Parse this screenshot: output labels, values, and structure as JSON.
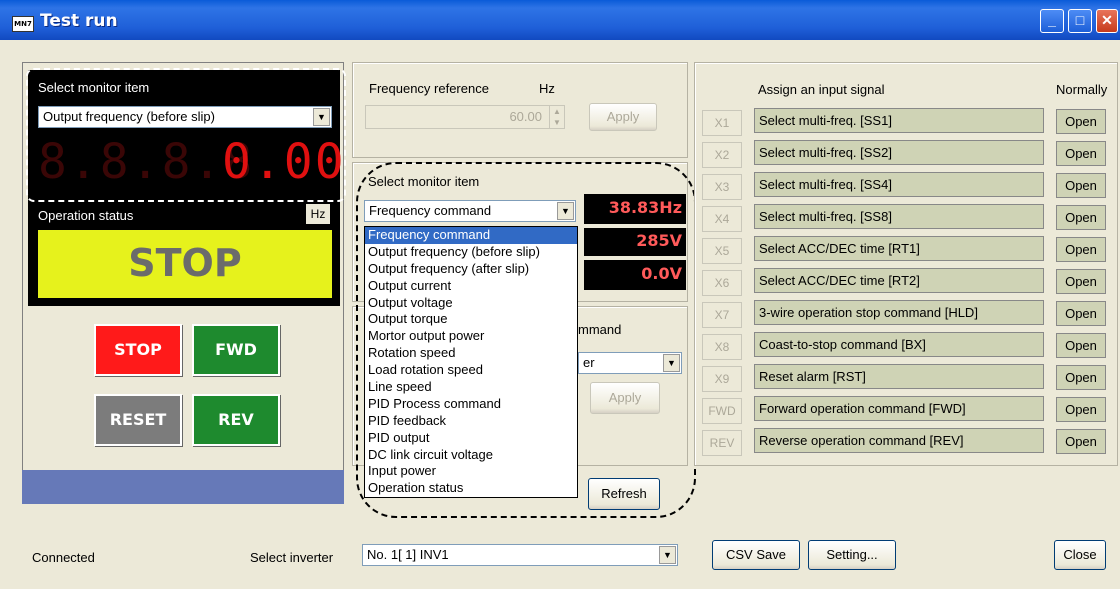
{
  "window": {
    "title": "Test run",
    "icon_label": "MN7",
    "controls": [
      "_",
      "□",
      "✕"
    ]
  },
  "left_panel": {
    "select_monitor_label": "Select monitor item",
    "monitor_selected": "Output frequency (before slip)",
    "seg_dim": "8.8.8.8",
    "seg_value": "0.00",
    "unit": "Hz",
    "operation_status_label": "Operation status",
    "status_value": "STOP",
    "buttons": {
      "stop": "STOP",
      "fwd": "FWD",
      "reset": "RESET",
      "rev": "REV"
    }
  },
  "frequency": {
    "label": "Frequency reference",
    "unit": "Hz",
    "value": "60.00",
    "apply": "Apply"
  },
  "middle": {
    "select_monitor_label": "Select monitor item",
    "selected": "Frequency command",
    "readouts": [
      "38.83Hz",
      "285V",
      "0.0V"
    ],
    "command_label_fragment": "mmand",
    "command_combo_fragment": "er",
    "apply": "Apply",
    "refresh": "Refresh"
  },
  "dropdown_options": [
    "Frequency command",
    "Output frequency (before slip)",
    "Output frequency (after slip)",
    "Output current",
    "Output voltage",
    "Output torque",
    "Mortor output power",
    "Rotation speed",
    "Load rotation speed",
    "Line speed",
    "PID Process command",
    "PID feedback",
    "PID output",
    "DC link circuit voltage",
    "Input power",
    "Operation status"
  ],
  "signals": {
    "header_assign": "Assign an input signal",
    "header_normally": "Normally",
    "rows": [
      {
        "x": "X1",
        "label": "Select multi-freq. [SS1]",
        "state": "Open"
      },
      {
        "x": "X2",
        "label": "Select multi-freq. [SS2]",
        "state": "Open"
      },
      {
        "x": "X3",
        "label": "Select multi-freq. [SS4]",
        "state": "Open"
      },
      {
        "x": "X4",
        "label": "Select multi-freq. [SS8]",
        "state": "Open"
      },
      {
        "x": "X5",
        "label": "Select ACC/DEC time [RT1]",
        "state": "Open"
      },
      {
        "x": "X6",
        "label": "Select ACC/DEC time [RT2]",
        "state": "Open"
      },
      {
        "x": "X7",
        "label": "3-wire operation stop command [HLD]",
        "state": "Open"
      },
      {
        "x": "X8",
        "label": "Coast-to-stop command [BX]",
        "state": "Open"
      },
      {
        "x": "X9",
        "label": "Reset alarm [RST]",
        "state": "Open"
      },
      {
        "x": "FWD",
        "label": "Forward operation command [FWD]",
        "state": "Open"
      },
      {
        "x": "REV",
        "label": "Reverse operation command [REV]",
        "state": "Open"
      }
    ]
  },
  "footer": {
    "status": "Connected",
    "select_inverter_label": "Select inverter",
    "inverter_value": "No. 1[ 1] INV1",
    "csv_save": "CSV Save",
    "setting": "Setting...",
    "close": "Close"
  },
  "colors": {
    "stop": "#FF1A1A",
    "fwd": "#1E8A2E",
    "reset": "#7C7C7C",
    "status_bg": "#E6F21C",
    "signal_bg": "#CFD3B5"
  }
}
